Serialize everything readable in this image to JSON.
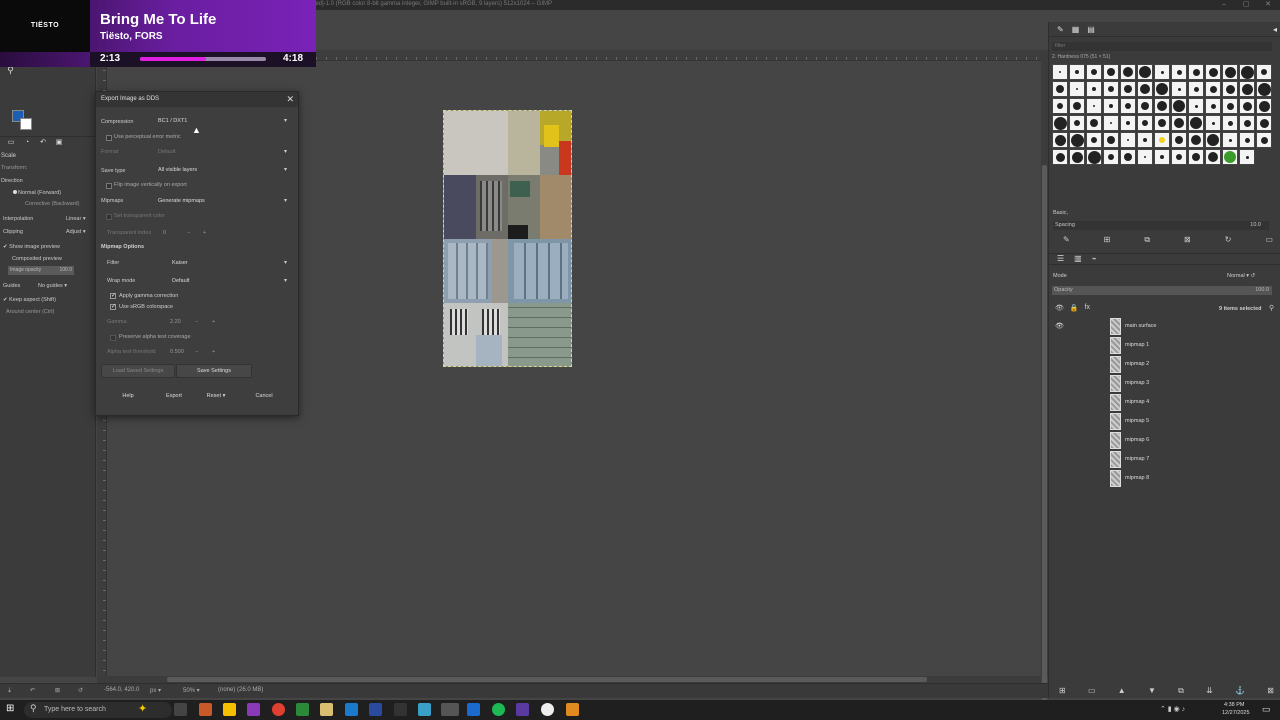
{
  "window": {
    "title": "[Untitled]-1.0 (RGB color 8-bit gamma integer, GIMP built-in sRGB, 9 layers) 512x1024 – GIMP"
  },
  "now_playing": {
    "logo": "TIËSTO",
    "title": "Bring Me To Life",
    "artist": "Tiësto, FORS",
    "elapsed": "2:13",
    "total": "4:18",
    "progress": 0.52
  },
  "tool_options": {
    "scale_label": "Scale",
    "transform_label": "Transform:",
    "direction_label": "Direction",
    "direction_normal": "Normal (Forward)",
    "direction_corrective": "Corrective (Backward)",
    "interpolation_label": "Interpolation",
    "interpolation_value": "Linear",
    "clipping_label": "Clipping",
    "clipping_value": "Adjust",
    "show_preview": "Show image preview",
    "composited_preview": "Composited preview",
    "image_opacity_label": "Image opacity",
    "image_opacity_value": "100.0",
    "guides_label": "Guides",
    "guides_value": "No guides",
    "keep_aspect": "Keep aspect (Shift)",
    "around_center": "Around center (Ctrl)"
  },
  "dialog": {
    "title": "Export Image as DDS",
    "compression_label": "Compression",
    "compression_value": "BC1 / DXT1",
    "perceptual_metric": "Use perceptual error metric",
    "format_label": "Format",
    "format_value": "Default",
    "save_type_label": "Save type",
    "save_type_value": "All visible layers",
    "flip_vertically": "Flip image vertically on export",
    "mipmaps_label": "Mipmaps",
    "mipmaps_value": "Generate mipmaps",
    "transparent_color": "Set transparent color",
    "transparent_index_label": "Transparent index",
    "transparent_index_value": "0",
    "mipmap_options_heading": "Mipmap Options",
    "filter_label": "Filter",
    "filter_value": "Kaiser",
    "wrap_mode_label": "Wrap mode",
    "wrap_mode_value": "Default",
    "apply_gamma": "Apply gamma correction",
    "use_srgb": "Use sRGB colorspace",
    "gamma_label": "Gamma",
    "gamma_value": "2.20",
    "preserve_alpha": "Preserve alpha test coverage",
    "alpha_threshold_label": "Alpha test threshold",
    "alpha_threshold_value": "0.500",
    "load_settings": "Load Saved Settings",
    "save_settings": "Save Settings",
    "help": "Help",
    "export": "Export",
    "reset": "Reset",
    "cancel": "Cancel"
  },
  "right_panel": {
    "brush_filter_placeholder": "filter",
    "brush_name": "2. Hardness 075 (51 × 51)",
    "preset": "Basic,",
    "spacing_label": "Spacing",
    "spacing_value": "10.0",
    "mode_label": "Mode",
    "mode_value": "Normal",
    "opacity_label": "Opacity",
    "opacity_value": "100.0",
    "items_selected": "9 items selected",
    "layers": [
      "main surface",
      "mipmap 1",
      "mipmap 2",
      "mipmap 3",
      "mipmap 4",
      "mipmap 5",
      "mipmap 6",
      "mipmap 7",
      "mipmap 8"
    ]
  },
  "status": {
    "coords": "-564.0, 420.0",
    "unit": "px",
    "zoom": "50%",
    "info": "(none) (26.0 MB)"
  },
  "taskbar": {
    "search_placeholder": "Type here to search",
    "time": "4:38 PM",
    "date": "12/27/2025"
  },
  "colors": {
    "accent_fg": "#1a5fb4",
    "bg_color": "#ffffff",
    "now_playing_progress": "#e020e0"
  }
}
